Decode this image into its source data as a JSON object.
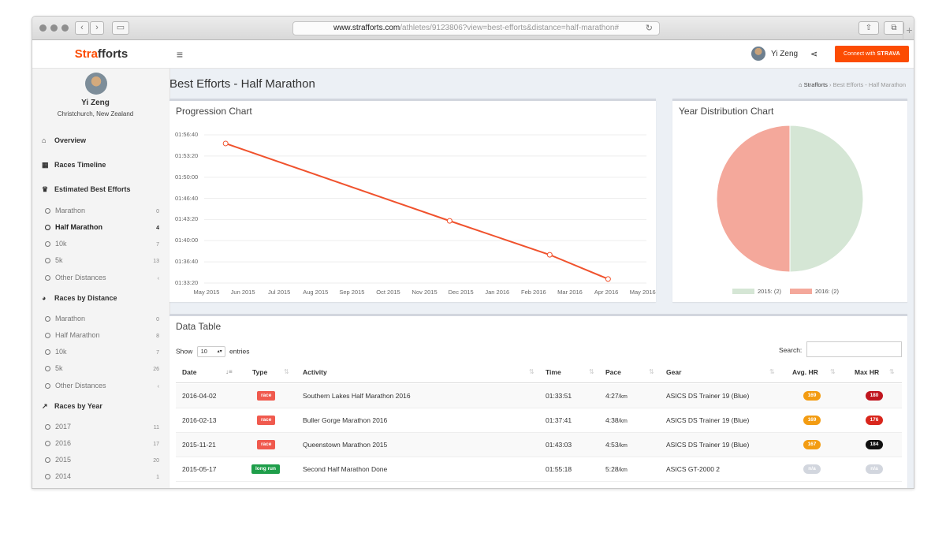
{
  "browser": {
    "url_host": "www.strafforts.com",
    "url_path": "/athletes/9123806?view=best-efforts&distance=half-marathon#"
  },
  "brand": {
    "part1": "Stra",
    "part2": "fforts",
    "accent": "#fc4c02"
  },
  "header": {
    "user_name": "Yi Zeng",
    "connect_prefix": "Connect with ",
    "connect_brand": "STRAVA"
  },
  "profile": {
    "name": "Yi Zeng",
    "location": "Christchurch, New Zealand"
  },
  "sidebar": {
    "overview": "Overview",
    "races_timeline": "Races Timeline",
    "best_efforts_header": "Estimated Best Efforts",
    "best_efforts": [
      {
        "label": "Marathon",
        "count": "0"
      },
      {
        "label": "Half Marathon",
        "count": "4"
      },
      {
        "label": "10k",
        "count": "7"
      },
      {
        "label": "5k",
        "count": "13"
      },
      {
        "label": "Other Distances",
        "count": "‹"
      }
    ],
    "by_distance_header": "Races by Distance",
    "by_distance": [
      {
        "label": "Marathon",
        "count": "0"
      },
      {
        "label": "Half Marathon",
        "count": "8"
      },
      {
        "label": "10k",
        "count": "7"
      },
      {
        "label": "5k",
        "count": "26"
      },
      {
        "label": "Other Distances",
        "count": "‹"
      }
    ],
    "by_year_header": "Races by Year",
    "by_year": [
      {
        "label": "2017",
        "count": "11"
      },
      {
        "label": "2016",
        "count": "17"
      },
      {
        "label": "2015",
        "count": "20"
      },
      {
        "label": "2014",
        "count": "1"
      }
    ]
  },
  "page": {
    "title": "Best Efforts - Half Marathon",
    "breadcrumb_home": "Strafforts",
    "breadcrumb_sep": "›",
    "breadcrumb_current": "Best Efforts - Half Marathon"
  },
  "progression": {
    "title": "Progression Chart",
    "y_ticks": [
      "01:56:40",
      "01:53:20",
      "01:50:00",
      "01:46:40",
      "01:43:20",
      "01:40:00",
      "01:36:40",
      "01:33:20"
    ],
    "x_ticks": [
      "May 2015",
      "Jun 2015",
      "Jul 2015",
      "Aug 2015",
      "Sep 2015",
      "Oct 2015",
      "Nov 2015",
      "Dec 2015",
      "Jan 2016",
      "Feb 2016",
      "Mar 2016",
      "Apr 2016",
      "May 2016"
    ]
  },
  "distribution": {
    "title": "Year Distribution Chart",
    "legend": [
      "2015: (2)",
      "2016: (2)"
    ]
  },
  "chart_data": [
    {
      "type": "line",
      "title": "Progression Chart",
      "ylabel": "Time",
      "y_unit": "h:mm:ss",
      "x": [
        "2015-05-17",
        "2015-11-21",
        "2016-02-13",
        "2016-04-02"
      ],
      "y": [
        "01:55:18",
        "01:43:03",
        "01:37:41",
        "01:33:51"
      ],
      "x_range": [
        "2015-05-01",
        "2016-05-01"
      ],
      "y_range": [
        "01:33:20",
        "01:56:40"
      ],
      "color": "#f0522d",
      "grid": true
    },
    {
      "type": "pie",
      "title": "Year Distribution Chart",
      "labels": [
        "2015",
        "2016"
      ],
      "values": [
        2,
        2
      ],
      "colors": [
        "#d5e6d5",
        "#f4a89b"
      ],
      "legend": "bottom"
    }
  ],
  "table": {
    "title": "Data Table",
    "show_label": "Show",
    "page_size": "10",
    "entries_label": "entries",
    "search_label": "Search:",
    "columns": [
      "Date",
      "Type",
      "Activity",
      "Time",
      "Pace",
      "Gear",
      "Avg. HR",
      "Max HR"
    ],
    "rows": [
      {
        "date": "2016-04-02",
        "type": "race",
        "type_color": "#f05a4e",
        "activity": "Southern Lakes Half Marathon 2016",
        "time": "01:33:51",
        "pace": "4:27",
        "pace_unit": "/km",
        "gear": "ASICS DS Trainer 19 (Blue)",
        "avg_hr": "169",
        "avg_color": "#f39c12",
        "max_hr": "180",
        "max_color": "#c0161f"
      },
      {
        "date": "2016-02-13",
        "type": "race",
        "type_color": "#f05a4e",
        "activity": "Buller Gorge Marathon 2016",
        "time": "01:37:41",
        "pace": "4:38",
        "pace_unit": "/km",
        "gear": "ASICS DS Trainer 19 (Blue)",
        "avg_hr": "169",
        "avg_color": "#f39c12",
        "max_hr": "176",
        "max_color": "#d9261c"
      },
      {
        "date": "2015-11-21",
        "type": "race",
        "type_color": "#f05a4e",
        "activity": "Queenstown Marathon 2015",
        "time": "01:43:03",
        "pace": "4:53",
        "pace_unit": "/km",
        "gear": "ASICS DS Trainer 19 (Blue)",
        "avg_hr": "167",
        "avg_color": "#f39c12",
        "max_hr": "184",
        "max_color": "#111111"
      },
      {
        "date": "2015-05-17",
        "type": "long run",
        "type_color": "#1e9e4a",
        "activity": "Second Half Marathon Done",
        "time": "01:55:18",
        "pace": "5:28",
        "pace_unit": "/km",
        "gear": "ASICS GT-2000 2",
        "avg_hr": "n/a",
        "avg_color": "#d2d6de",
        "max_hr": "n/a",
        "max_color": "#d2d6de"
      }
    ]
  }
}
